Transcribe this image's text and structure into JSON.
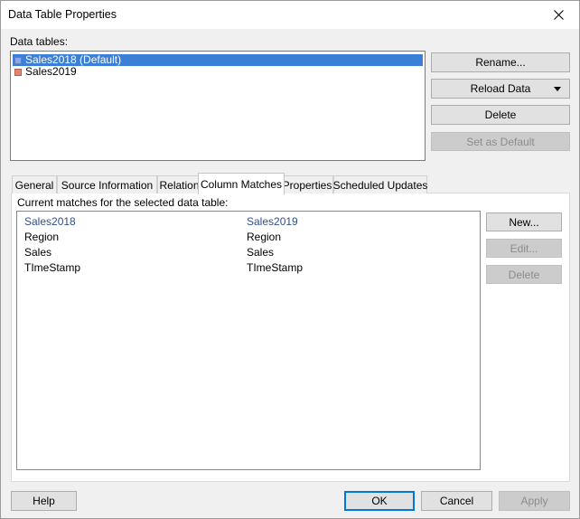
{
  "window": {
    "title": "Data Table Properties"
  },
  "data_tables": {
    "label": "Data tables:",
    "items": [
      {
        "name": "Sales2018 (Default)",
        "color": "#8aa8ef",
        "selected": true
      },
      {
        "name": "Sales2019",
        "color": "#e8826f",
        "selected": false
      }
    ]
  },
  "side_buttons": {
    "rename": "Rename...",
    "reload": "Reload Data",
    "delete": "Delete",
    "set_default": "Set as Default"
  },
  "tabs": [
    {
      "label": "General"
    },
    {
      "label": "Source Information"
    },
    {
      "label": "Relations"
    },
    {
      "label": "Column Matches",
      "active": true
    },
    {
      "label": "Properties"
    },
    {
      "label": "Scheduled Updates"
    }
  ],
  "column_matches": {
    "label": "Current matches for the selected data table:",
    "headers": [
      "Sales2018",
      "Sales2019"
    ],
    "rows": [
      [
        "Region",
        "Region"
      ],
      [
        "Sales",
        "Sales"
      ],
      [
        "TImeStamp",
        "TImeStamp"
      ]
    ],
    "buttons": {
      "new": "New...",
      "edit": "Edit...",
      "delete": "Delete"
    }
  },
  "footer": {
    "help": "Help",
    "ok": "OK",
    "cancel": "Cancel",
    "apply": "Apply"
  }
}
